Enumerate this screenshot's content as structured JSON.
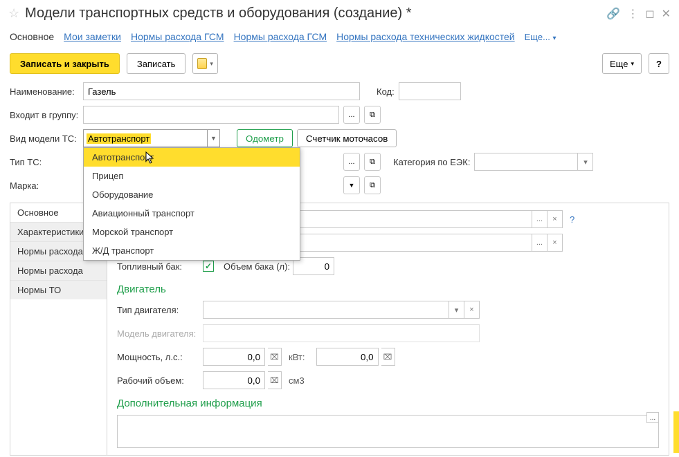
{
  "titlebar": {
    "title": "Модели транспортных средств и оборудования  (создание) *"
  },
  "top_tabs": {
    "t0": "Основное",
    "t1": "Мои заметки",
    "t2": "Нормы расхода ГСМ",
    "t3": "Нормы расхода ГСМ",
    "t4": "Нормы расхода технических жидкостей",
    "more": "Еще..."
  },
  "toolbar": {
    "save_close": "Записать и закрыть",
    "save": "Записать",
    "more": "Еще",
    "more_caret": "▾",
    "help": "?"
  },
  "fields": {
    "name_label": "Наименование:",
    "name_value": "Газель",
    "code_label": "Код:",
    "code_value": "",
    "group_label": "Входит в группу:",
    "group_value": "",
    "dots": "...",
    "open_icon": "⧉",
    "type_model_label": "Вид модели ТС:",
    "type_model_value": "Автотранспорт",
    "odometer": "Одометр",
    "motohours": "Счетчик моточасов",
    "type_ts_label": "Тип ТС:",
    "cat_eek_label": "Категория по ЕЭК:",
    "marka_label": "Марка:"
  },
  "dropdown": {
    "o0": "Автотранспорт",
    "o1": "Прицеп",
    "o2": "Оборудование",
    "o3": "Авиационный транспорт",
    "o4": "Морской транспорт",
    "o5": "Ж/Д транспорт"
  },
  "side_tabs": {
    "s0": "Основное",
    "s1": "Характеристики",
    "s2": "Нормы расхода",
    "s3": "Нормы расхода",
    "s4": "Нормы ТО"
  },
  "panel": {
    "fuel_tank_label": "Топливный бак:",
    "tank_vol_label": "Объем бака (л):",
    "tank_vol_value": "0",
    "engine_header": "Двигатель",
    "engine_type_label": "Тип двигателя:",
    "engine_model_label": "Модель двигателя:",
    "power_label": "Мощность, л.с.:",
    "power_value": "0,0",
    "kvt_label": "кВт:",
    "kvt_value": "0,0",
    "disp_label": "Рабочий объем:",
    "disp_value": "0,0",
    "cm3": "см3",
    "addinfo_header": "Дополнительная информация",
    "calc_icon": "⌧",
    "check": "✓",
    "clear": "×",
    "caret": "▾",
    "dots": "...",
    "q": "?"
  }
}
